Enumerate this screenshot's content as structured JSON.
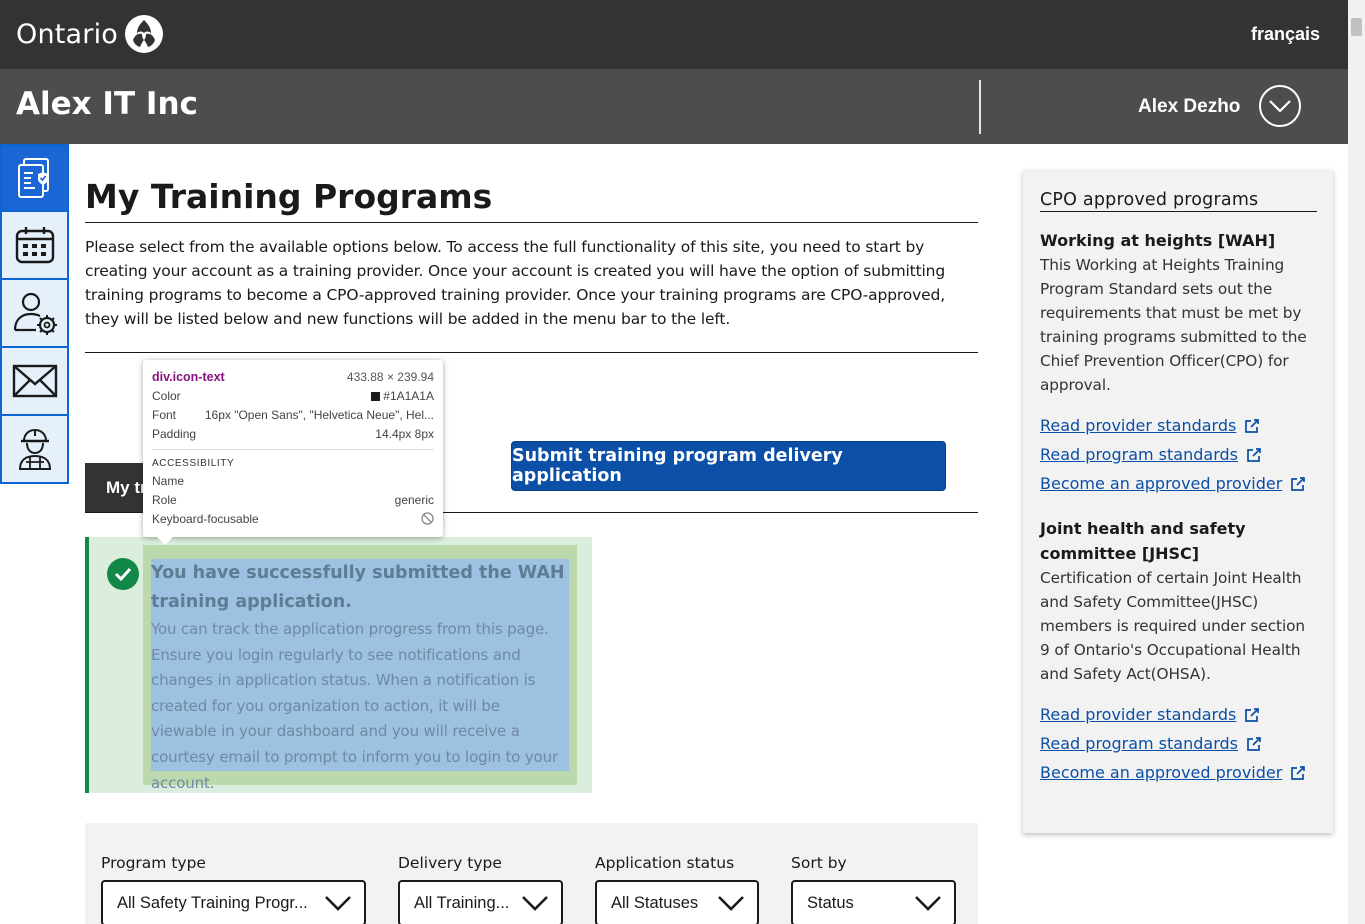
{
  "header": {
    "logo_text": "Ontario",
    "language_link": "français"
  },
  "orgbar": {
    "org_name": "Alex IT Inc",
    "user_name": "Alex Dezho"
  },
  "rail": {
    "items": [
      "documents-icon",
      "calendar-icon",
      "user-settings-icon",
      "mail-icon",
      "worker-icon"
    ]
  },
  "main": {
    "title": "My Training Programs",
    "intro": "Please select from the available options below. To access the full functionality of this site, you need to start by creating your account as a training provider. Once your account is created you will have the option of submitting training programs to become a CPO-approved training provider. Once your training programs are CPO-approved, they will be listed below and new functions will be added in the menu bar to the left.",
    "tab_label": "My training programs",
    "submit_button": "Submit training program delivery application"
  },
  "callout": {
    "title": "You have successfully submitted the WAH training application.",
    "text": "You can track the application progress from this page. Ensure you login regularly to see notifications and changes in application status. When a notification is created for you organization to action, it will be viewable in your dashboard and you will receive a courtesy email to prompt to inform you to login to your account."
  },
  "filters": {
    "program_type": {
      "label": "Program type",
      "value": "All Safety Training Progr..."
    },
    "delivery_type": {
      "label": "Delivery type",
      "value": "All Training..."
    },
    "application_status": {
      "label": "Application status",
      "value": "All Statuses"
    },
    "sort_by": {
      "label": "Sort by",
      "value": "Status"
    }
  },
  "tooltip": {
    "tag": "div.icon-text",
    "size": "433.88 × 239.94",
    "color_label": "Color",
    "color_value": "#1A1A1A",
    "font_label": "Font",
    "font_value": "16px \"Open Sans\", \"Helvetica Neue\", Hel...",
    "padding_label": "Padding",
    "padding_value": "14.4px 8px",
    "section": "ACCESSIBILITY",
    "name_label": "Name",
    "name_value": "",
    "role_label": "Role",
    "role_value": "generic",
    "focus_label": "Keyboard-focusable"
  },
  "sidebar": {
    "title": "CPO approved programs",
    "sections": [
      {
        "heading": "Working at heights [WAH]",
        "description": "This Working at Heights Training Program Standard sets out the requirements that must be met by training programs submitted to the Chief Prevention Officer(CPO) for approval.",
        "links": [
          "Read provider standards",
          "Read program standards",
          "Become an approved provider"
        ]
      },
      {
        "heading": "Joint health and safety committee [JHSC]",
        "description": "Certification of certain Joint Health and Safety Committee(JHSC) members is required under section 9 of Ontario's Occupational Health and Safety Act(OHSA).",
        "links": [
          "Read provider standards",
          "Read program standards",
          "Become an approved provider"
        ]
      }
    ]
  },
  "colors": {
    "topbar": "#333333",
    "orgbar": "#4d4d4d",
    "primary": "#0b4fa6",
    "success": "#118847",
    "rail_active": "#1a66d4"
  }
}
